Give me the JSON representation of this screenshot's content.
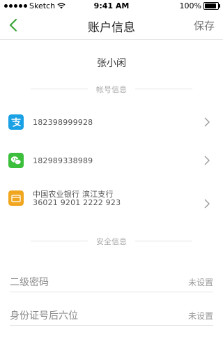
{
  "status_bar": {
    "carrier": "Sketch",
    "time": "9:41 AM",
    "battery": "100%",
    "battery_level": 1.0
  },
  "nav": {
    "title": "账户信息",
    "save_label": "保存"
  },
  "profile": {
    "username": "张小闲"
  },
  "sections": {
    "account_info": "帐号信息",
    "security_info": "安全信息"
  },
  "accounts": [
    {
      "icon": "alipay-icon",
      "color": "#1aa1e5",
      "line1": "182398999928",
      "line2": ""
    },
    {
      "icon": "wechat-icon",
      "color": "#3cbf3c",
      "line1": "182989338989",
      "line2": ""
    },
    {
      "icon": "bank-card-icon",
      "color": "#f0a61f",
      "line1": "中国农业银行   滨江支行",
      "line2": "36021 9201 2222  923"
    }
  ],
  "security": [
    {
      "label": "二级密码",
      "value": "未设置"
    },
    {
      "label": "身份证号后六位",
      "value": "未设置"
    }
  ]
}
